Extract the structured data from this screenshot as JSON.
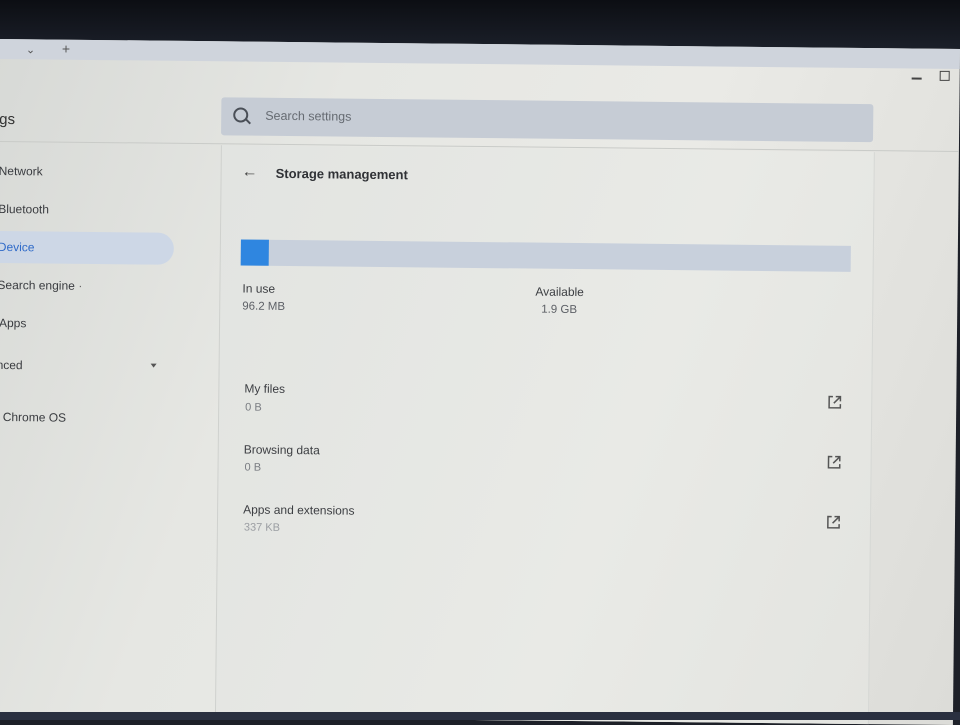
{
  "window": {
    "title_fragment": "gs"
  },
  "search": {
    "placeholder": "Search settings"
  },
  "sidebar": {
    "items": [
      {
        "label": "Network"
      },
      {
        "label": "Bluetooth"
      },
      {
        "label": "Device",
        "active": true
      },
      {
        "label": "Search engine"
      },
      {
        "label": "Apps"
      },
      {
        "label": "nced",
        "expandable": true
      },
      {
        "label": "t Chrome OS"
      }
    ]
  },
  "main": {
    "title": "Storage management",
    "storage": {
      "in_use_label": "In use",
      "in_use_value": "96.2 MB",
      "available_label": "Available",
      "available_value": "1.9 GB",
      "used_fraction": 0.046
    },
    "rows": [
      {
        "label": "My files",
        "value": "0 B",
        "icon": "external-link-icon"
      },
      {
        "label": "Browsing data",
        "value": "0 B",
        "icon": "external-link-icon"
      },
      {
        "label": "Apps and extensions",
        "value": "337 KB",
        "icon": "external-link-icon"
      }
    ]
  },
  "colors": {
    "accent": "#2f86e0",
    "active_bg": "#cdd7e6",
    "bar_track": "#c8d0dc"
  }
}
